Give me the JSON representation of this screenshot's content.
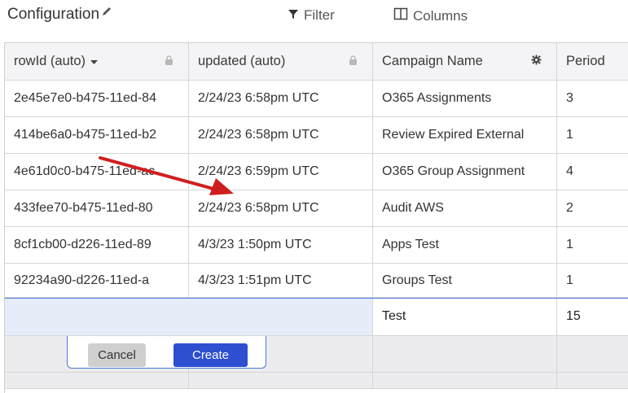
{
  "toolbar": {
    "title": "Configuration",
    "filter_label": "Filter",
    "columns_label": "Columns"
  },
  "grid": {
    "headers": [
      {
        "label": "rowId (auto)",
        "icon": "lock-icon",
        "sort": "chevron-down-icon"
      },
      {
        "label": "updated (auto)",
        "icon": "lock-icon"
      },
      {
        "label": "Campaign Name",
        "icon": "gear-icon"
      },
      {
        "label": "Period"
      }
    ],
    "rows": [
      {
        "rowId": "2e45e7e0-b475-11ed-84",
        "updated": "2/24/23 6:58pm UTC",
        "campaign": "O365 Assignments",
        "period": "3"
      },
      {
        "rowId": "414be6a0-b475-11ed-b2",
        "updated": "2/24/23 6:58pm UTC",
        "campaign": "Review Expired External",
        "period": "1"
      },
      {
        "rowId": "4e61d0c0-b475-11ed-ac",
        "updated": "2/24/23 6:59pm UTC",
        "campaign": "O365 Group Assignment",
        "period": "4"
      },
      {
        "rowId": "433fee70-b475-11ed-80",
        "updated": "2/24/23 6:58pm UTC",
        "campaign": "Audit AWS",
        "period": "2"
      },
      {
        "rowId": "8cf1cb00-d226-11ed-89",
        "updated": "4/3/23 1:50pm UTC",
        "campaign": "Apps Test",
        "period": "1"
      },
      {
        "rowId": "92234a90-d226-11ed-a",
        "updated": "4/3/23 1:51pm UTC",
        "campaign": "Groups Test",
        "period": "1"
      }
    ],
    "new_row": {
      "campaign": "Test",
      "period": "15"
    }
  },
  "actions": {
    "cancel_label": "Cancel",
    "create_label": "Create"
  },
  "colors": {
    "accent": "#2d4fd0",
    "new_row_bg": "#e6ecf8",
    "annotation_arrow": "#d01e1e"
  }
}
